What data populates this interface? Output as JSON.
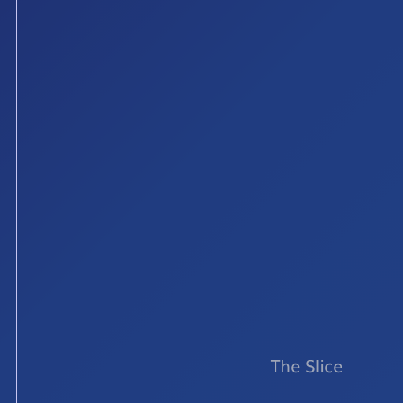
{
  "caption": {
    "text": "The Slice"
  },
  "colors": {
    "background_start": "#1f3274",
    "background_end": "#213f83",
    "left_rule": "#c9c7f2",
    "caption_text": "#9da4b7"
  }
}
